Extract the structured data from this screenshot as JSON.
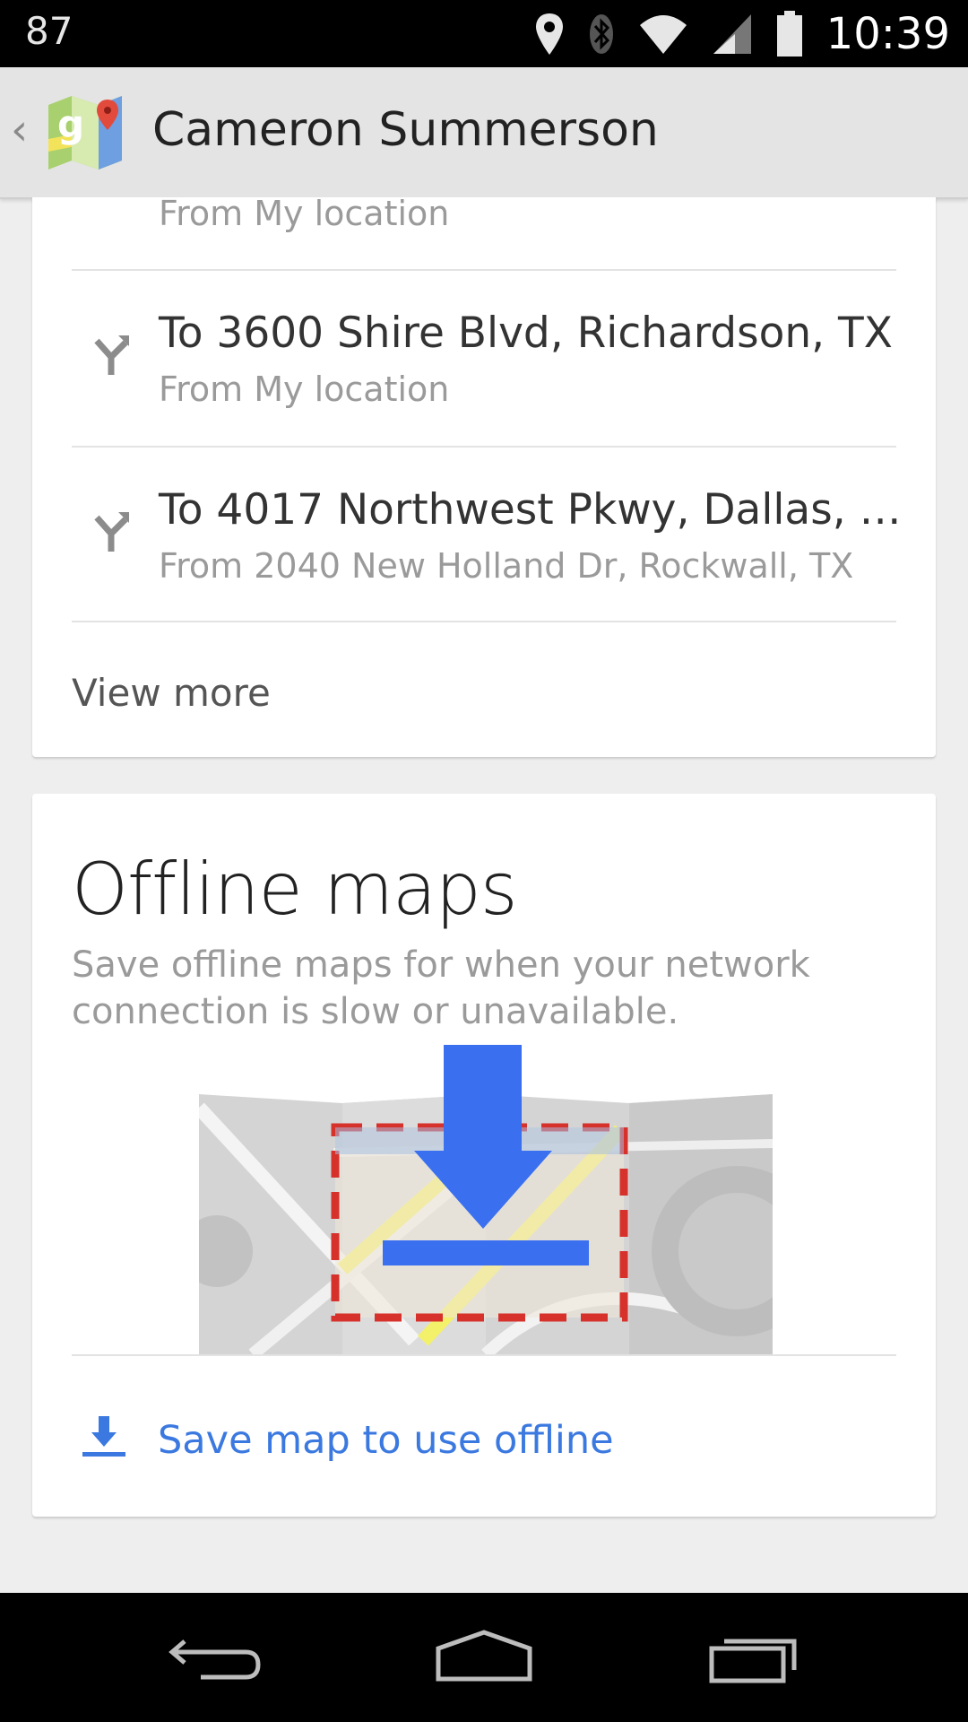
{
  "status_bar": {
    "left_number": "87",
    "time": "10:39",
    "icons": [
      "location-icon",
      "bluetooth-icon",
      "wifi-icon",
      "signal-icon",
      "battery-icon"
    ]
  },
  "action_bar": {
    "back_glyph": "‹",
    "title": "Cameron Summerson",
    "logo": "maps-logo"
  },
  "recent_directions": {
    "partial_sub": "From My location",
    "items": [
      {
        "title": "To 3600 Shire Blvd, Richardson, TX",
        "subtitle": "From My location",
        "icon": "directions-icon"
      },
      {
        "title": "To 4017 Northwest Pkwy, Dallas, …",
        "subtitle": "From 2040 New Holland Dr, Rockwall, TX",
        "icon": "directions-icon"
      }
    ],
    "view_more": "View more"
  },
  "offline_maps": {
    "title": "Offline maps",
    "description": "Save offline maps for when your network connection is slow or unavailable.",
    "action_label": "Save map to use offline",
    "action_icon": "download-icon",
    "accent_color": "#3b79e0"
  },
  "nav_bar": {
    "buttons": [
      "back-icon",
      "home-icon",
      "recents-icon"
    ]
  }
}
